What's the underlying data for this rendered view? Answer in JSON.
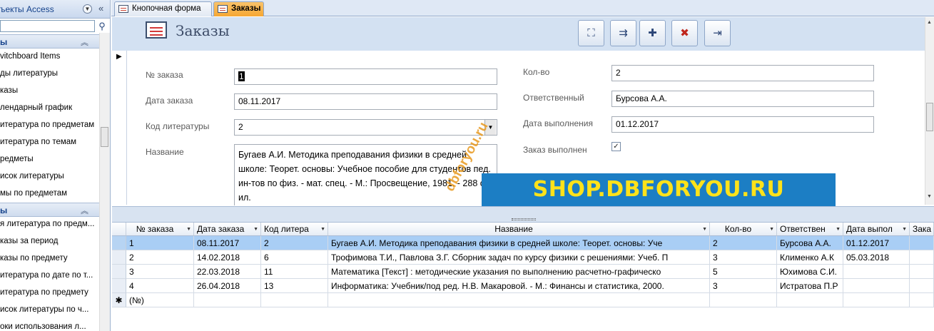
{
  "nav": {
    "title": "ъекты Access",
    "groups": [
      {
        "label": "ы",
        "items": [
          "vitchboard Items",
          "ды литературы",
          "казы",
          "лендарный график",
          "итература по предметам",
          "итература по темам",
          "редметы",
          "исок литературы",
          "мы по предметам"
        ]
      },
      {
        "label": "ы",
        "items": [
          "я литература по предм...",
          "казы за период",
          "казы по предмету",
          "итература по дате по т...",
          "итература по предмету",
          "исок литературы по ч...",
          "оки использования л..."
        ]
      }
    ]
  },
  "tabs": [
    {
      "label": "Кнопочная форма"
    },
    {
      "label": "Заказы"
    }
  ],
  "form": {
    "title": "Заказы",
    "toolbar_icons": [
      "find-icon",
      "find-next-icon",
      "new-record-icon",
      "delete-record-icon",
      "close-form-icon"
    ],
    "fields": {
      "order_no": {
        "label": "№ заказа",
        "value": "1"
      },
      "order_date": {
        "label": "Дата заказа",
        "value": "08.11.2017"
      },
      "lit_code": {
        "label": "Код литературы",
        "value": "2"
      },
      "title": {
        "label": "Название",
        "value": "Бугаев А.И. Методика преподавания физики в средней школе: Теорет. основы: Учебное пособие для студентов пед. ин-тов по физ. - мат. спец. - М.: Просвещение, 1981. - 288 с., ил."
      },
      "qty": {
        "label": "Кол-во",
        "value": "2"
      },
      "responsible": {
        "label": "Ответственный",
        "value": "Бурсова А.А."
      },
      "done_date": {
        "label": "Дата выполнения",
        "value": "01.12.2017"
      },
      "done": {
        "label": "Заказ выполнен",
        "checked": true
      }
    }
  },
  "watermarks": {
    "banner": "SHOP.DBFORYOU.RU",
    "diagonal": "dbforyou.ru"
  },
  "datasheet": {
    "columns": [
      "№ заказа",
      "Дата заказа",
      "Код литера",
      "Название",
      "Кол-во",
      "Ответствен",
      "Дата выпол",
      "Зака"
    ],
    "rows": [
      [
        "1",
        "08.11.2017",
        "2",
        "Бугаев А.И. Методика преподавания физики в средней школе: Теорет. основы: Уче",
        "2",
        "Бурсова А.А.",
        "01.12.2017",
        ""
      ],
      [
        "2",
        "14.02.2018",
        "6",
        "Трофимова Т.И., Павлова З.Г. Сборник задач по курсу физики с решениями: Учеб. П",
        "3",
        "Клименко А.К",
        "05.03.2018",
        ""
      ],
      [
        "3",
        "22.03.2018",
        "11",
        "Математика [Текст] : методические указания по выполнению расчетно-графическо",
        "5",
        "Юхимова С.И.",
        "",
        ""
      ],
      [
        "4",
        "26.04.2018",
        "13",
        "Информатика: Учебник/под ред. Н.В. Макаровой. - М.: Финансы и статистика, 2000.",
        "3",
        "Истратова П.Р",
        "",
        ""
      ]
    ],
    "new_row_label": "(№)"
  }
}
